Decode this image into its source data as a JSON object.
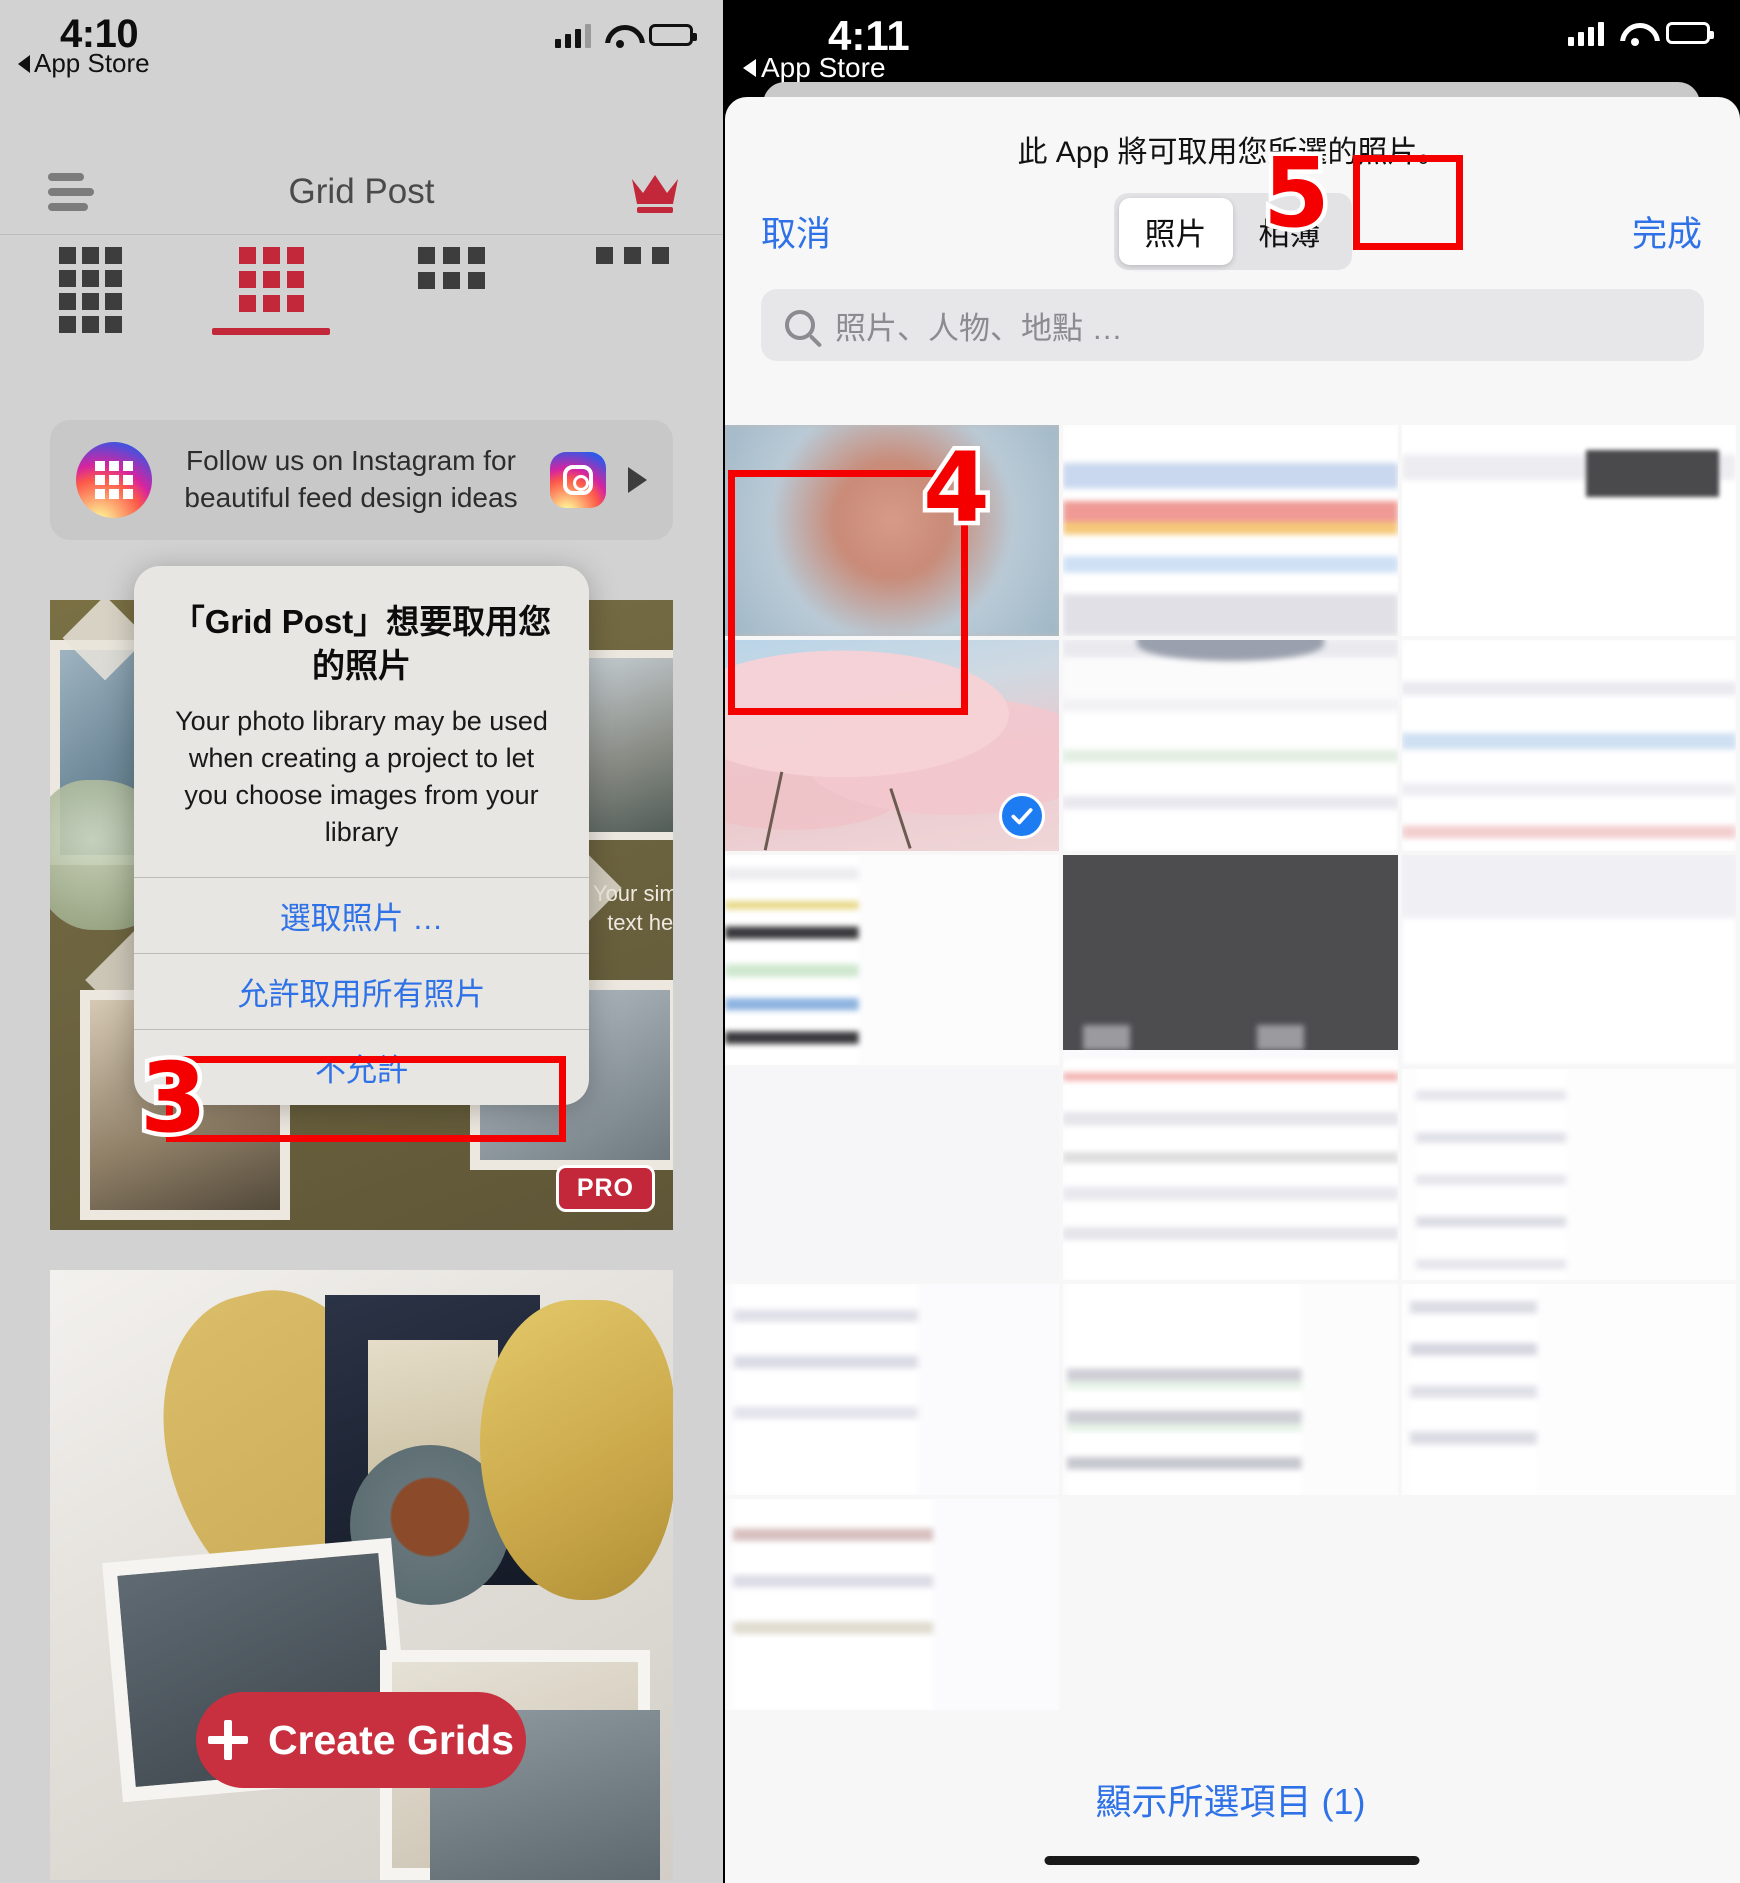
{
  "left_screen": {
    "status_bar": {
      "time": "4:10",
      "back_link": "App Store",
      "icons": [
        "signal-icon",
        "wifi-icon",
        "battery-icon"
      ]
    },
    "nav": {
      "title": "Grid Post",
      "menu_icon": "hamburger-icon",
      "premium_icon": "crown-icon"
    },
    "tabs": [
      {
        "name": "grid-4x3",
        "active": false
      },
      {
        "name": "grid-3x3",
        "active": true
      },
      {
        "name": "grid-3x2",
        "active": false
      },
      {
        "name": "more-dots",
        "active": false
      }
    ],
    "banner": {
      "text": "Follow us on Instagram for beautiful feed design ideas",
      "line1": "Follow us on Instagram for",
      "line2": "beautiful feed design ideas",
      "logo_icon": "grid-post-logo-icon",
      "badge_icon": "instagram-icon",
      "play_icon": "play-triangle-icon"
    },
    "collage": {
      "text_line1": "Your simple",
      "text_line2": "text here",
      "text2_line1": "Your simple",
      "text2_line2": "text here",
      "pro_badge": "PRO"
    },
    "create_button": {
      "label": "Create Grids",
      "icon": "plus-icon"
    },
    "alert": {
      "title": "「Grid Post」想要取用您的照片",
      "message": "Your photo library may be used when creating a project to let you choose images from your library",
      "buttons": [
        {
          "label": "選取照片 …",
          "highlighted": false
        },
        {
          "label": "允許取用所有照片",
          "highlighted": true
        },
        {
          "label": "不允許",
          "highlighted": false
        }
      ]
    },
    "annotation": {
      "step": "3",
      "color": "#f50000"
    }
  },
  "right_screen": {
    "status_bar": {
      "time": "4:11",
      "back_link": "App Store",
      "icons": [
        "signal-icon",
        "wifi-icon",
        "battery-icon"
      ]
    },
    "sheet": {
      "note": "此 App 將可取用您所選的照片。",
      "cancel_label": "取消",
      "done_label": "完成",
      "segments": [
        {
          "label": "照片",
          "active": true
        },
        {
          "label": "相簿",
          "active": false
        }
      ],
      "search_placeholder": "照片、人物、地點 …",
      "search_icon": "magnifier-icon",
      "show_selected_label": "顯示所選項目 (1)",
      "selected_count": 1
    },
    "annotations": [
      {
        "step": "4",
        "color": "#f50000",
        "target": "selected-photo-thumbnail"
      },
      {
        "step": "5",
        "color": "#f50000",
        "target": "done-button"
      }
    ],
    "selected_photo": {
      "name": "cherry-blossom-photo",
      "checkmark_icon": "check-circle-icon",
      "selected": true
    }
  },
  "colors": {
    "accent_red": "#c8303f",
    "link_blue": "#2f72e8",
    "annotation_red": "#f50000",
    "sheet_bg": "#f7f7f8",
    "left_bg": "#d2d2d2"
  }
}
